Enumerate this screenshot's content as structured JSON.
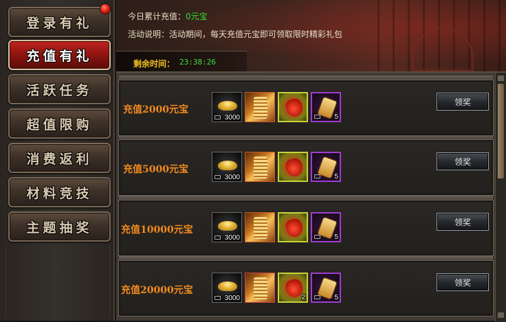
{
  "sidebar": {
    "items": [
      {
        "label": "登录有礼",
        "active": false,
        "has_notification": true
      },
      {
        "label": "充值有礼",
        "active": true,
        "has_notification": false
      },
      {
        "label": "活跃任务",
        "active": false,
        "has_notification": false
      },
      {
        "label": "超值限购",
        "active": false,
        "has_notification": false
      },
      {
        "label": "消费返利",
        "active": false,
        "has_notification": false
      },
      {
        "label": "材料竞技",
        "active": false,
        "has_notification": false
      },
      {
        "label": "主题抽奖",
        "active": false,
        "has_notification": false
      }
    ]
  },
  "header": {
    "recharge_label": "今日累计充值：",
    "recharge_value": "0元宝",
    "desc_label": "活动说明：",
    "desc_text": "活动期间，每天充值元宝即可领取限时精彩礼包",
    "timer_label": "剩余时间：",
    "timer_value": "23:38:26"
  },
  "tiers": [
    {
      "title": "充值2000元宝",
      "claim_label": "领奖",
      "items": [
        {
          "icon": "gold-ingot-icon",
          "qty": "3000"
        },
        {
          "icon": "scroll-icon",
          "qty": ""
        },
        {
          "icon": "red-bag-icon",
          "qty": ""
        },
        {
          "icon": "token-icon",
          "qty": "5"
        }
      ]
    },
    {
      "title": "充值5000元宝",
      "claim_label": "领奖",
      "items": [
        {
          "icon": "gold-ingot-icon",
          "qty": "3000"
        },
        {
          "icon": "scroll-icon",
          "qty": ""
        },
        {
          "icon": "red-bag-icon",
          "qty": ""
        },
        {
          "icon": "token-icon",
          "qty": "5"
        }
      ]
    },
    {
      "title": "充值10000元宝",
      "claim_label": "领奖",
      "items": [
        {
          "icon": "gold-ingot-icon",
          "qty": "3000"
        },
        {
          "icon": "scroll-icon",
          "qty": ""
        },
        {
          "icon": "red-bag-icon",
          "qty": ""
        },
        {
          "icon": "token-icon",
          "qty": "5"
        }
      ]
    },
    {
      "title": "充值20000元宝",
      "claim_label": "领奖",
      "items": [
        {
          "icon": "gold-ingot-icon",
          "qty": "3000"
        },
        {
          "icon": "scroll-icon",
          "qty": ""
        },
        {
          "icon": "red-bag-icon",
          "qty": "2"
        },
        {
          "icon": "token-icon",
          "qty": "5"
        }
      ]
    }
  ],
  "colors": {
    "accent_orange": "#f28a1e",
    "timer_green": "#3fe03f",
    "timer_label_yellow": "#f0c020",
    "active_red": "#8d1410"
  }
}
